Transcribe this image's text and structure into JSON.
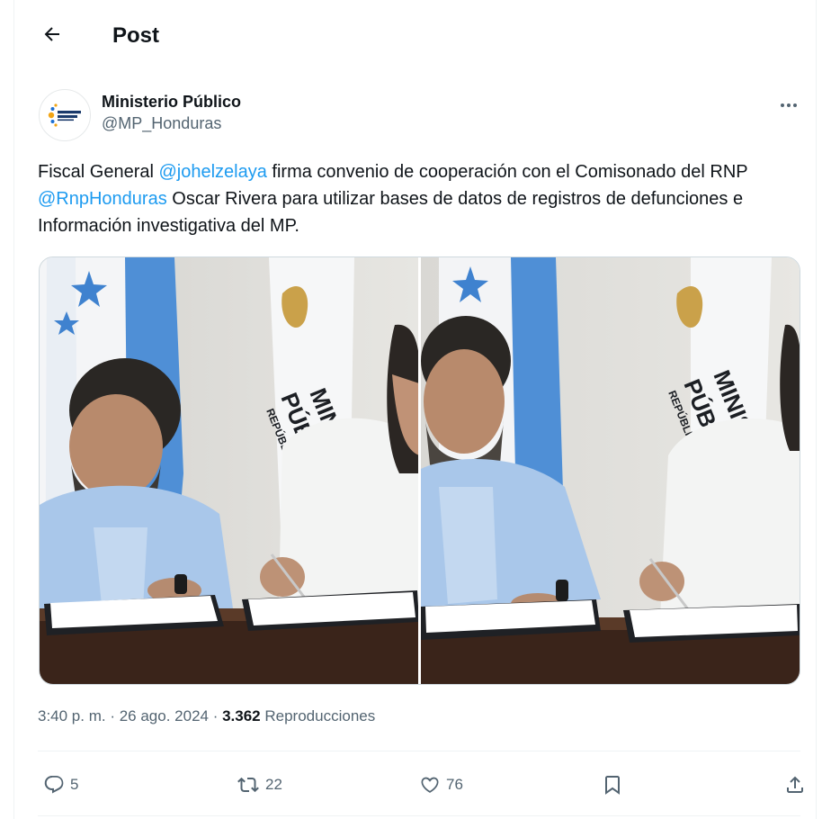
{
  "header": {
    "title": "Post",
    "back_icon": "arrow-left-icon"
  },
  "author": {
    "name": "Ministerio Público",
    "handle": "@MP_Honduras",
    "avatar_logo_text": "MINISTERIO PÚBLICO"
  },
  "tweet": {
    "segments": [
      {
        "text": "Fiscal General ",
        "mention": false
      },
      {
        "text": "@johelzelaya",
        "mention": true
      },
      {
        "text": " firma convenio de cooperación con el Comisonado del RNP ",
        "mention": false
      },
      {
        "text": "@RnpHonduras",
        "mention": true
      },
      {
        "text": " Oscar Rivera para utilizar bases de datos de registros de defunciones e Información investigativa del MP.",
        "mention": false
      }
    ]
  },
  "media": {
    "photos": [
      {
        "name": "photo-signing-left",
        "banner_text": "MINISTERIO PÚBLICO",
        "sub_text": "REPÚBLICA DE"
      },
      {
        "name": "photo-signing-right",
        "banner_text": "MINISTERIO PÚBLICO",
        "sub_text": "REPÚBLICA DE"
      }
    ]
  },
  "meta": {
    "time": "3:40 p. m.",
    "date": "26 ago. 2024",
    "separator": " · ",
    "views_count": "3.362",
    "views_label": "Reproducciones"
  },
  "actions": {
    "reply_count": "5",
    "repost_count": "22",
    "like_count": "76"
  },
  "colors": {
    "accent": "#1d9bf0",
    "secondary_text": "#536471",
    "border": "#eff3f4"
  }
}
